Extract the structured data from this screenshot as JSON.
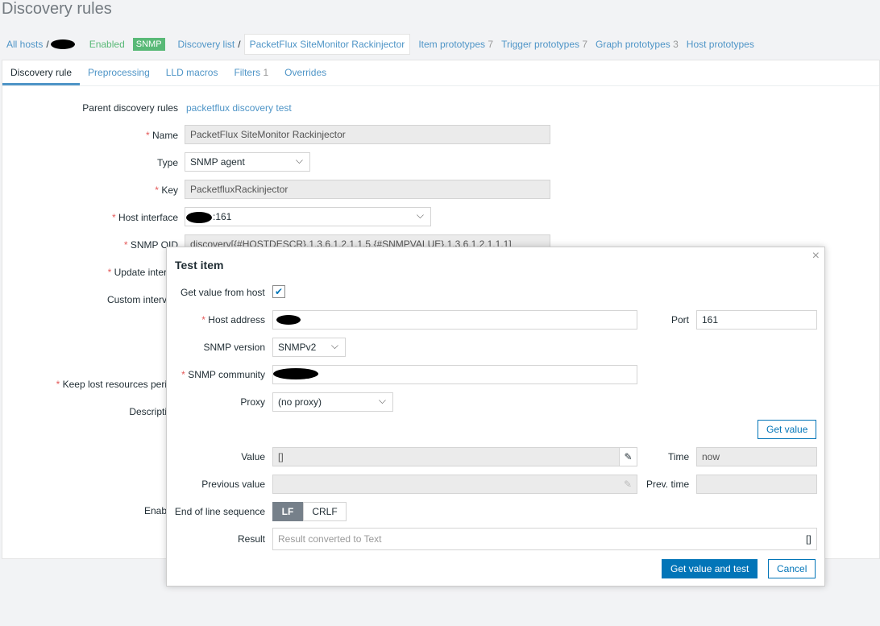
{
  "page_title": "Discovery rules",
  "breadcrumb": {
    "all_hosts": "All hosts",
    "status": "Enabled",
    "snmp_badge": "SNMP",
    "discovery_list": "Discovery list",
    "current": "PacketFlux SiteMonitor Rackinjector",
    "links": [
      {
        "label": "Item prototypes",
        "count": "7"
      },
      {
        "label": "Trigger prototypes",
        "count": "7"
      },
      {
        "label": "Graph prototypes",
        "count": "3"
      },
      {
        "label": "Host prototypes",
        "count": ""
      }
    ]
  },
  "tabs": [
    {
      "label": "Discovery rule",
      "count": ""
    },
    {
      "label": "Preprocessing",
      "count": ""
    },
    {
      "label": "LLD macros",
      "count": ""
    },
    {
      "label": "Filters",
      "count": "1"
    },
    {
      "label": "Overrides",
      "count": ""
    }
  ],
  "form": {
    "parent_label": "Parent discovery rules",
    "parent_value": "packetflux discovery test",
    "name_label": "Name",
    "name_value": "PacketFlux SiteMonitor Rackinjector",
    "type_label": "Type",
    "type_value": "SNMP agent",
    "key_label": "Key",
    "key_value": "PacketfluxRackinjector",
    "iface_label": "Host interface",
    "iface_value": ":161",
    "oid_label": "SNMP OID",
    "oid_value": "discovery[{#HOSTDESCR},1.3.6.1.2.1.1.5,{#SNMPVALUE},1.3.6.1.2.1.1.1]",
    "update_label": "Update inter",
    "custom_label": "Custom interv",
    "keep_label": "Keep lost resources peri",
    "desc_label": "Descripti",
    "enabled_label": "Enab"
  },
  "modal": {
    "title": "Test item",
    "close": "×",
    "get_from_host_label": "Get value from host",
    "host_label": "Host address",
    "port_label": "Port",
    "port_value": "161",
    "snmp_ver_label": "SNMP version",
    "snmp_ver_value": "SNMPv2",
    "community_label": "SNMP community",
    "proxy_label": "Proxy",
    "proxy_value": "(no proxy)",
    "get_value_btn": "Get value",
    "value_label": "Value",
    "value_value": "[]",
    "time_label": "Time",
    "time_value": "now",
    "prev_label": "Previous value",
    "prev_time_label": "Prev. time",
    "eol_label": "End of line sequence",
    "eol_lf": "LF",
    "eol_crlf": "CRLF",
    "result_label": "Result",
    "result_placeholder": "Result converted to Text",
    "result_value": "[]",
    "test_btn": "Get value and test",
    "cancel_btn": "Cancel"
  }
}
